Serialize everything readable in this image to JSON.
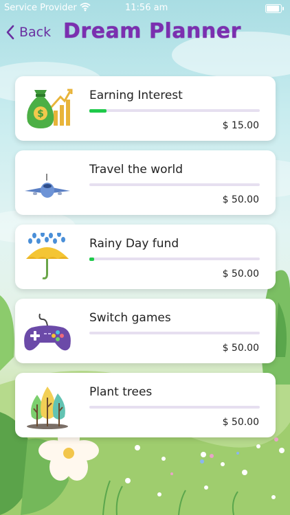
{
  "status_bar": {
    "carrier": "Service Provider",
    "time": "11:56 am"
  },
  "nav": {
    "back_label": "Back",
    "title": "Dream Planner"
  },
  "goals": [
    {
      "name": "Earning Interest",
      "amount": "$ 15.00",
      "progress": 0.1,
      "icon": "money-bag-icon"
    },
    {
      "name": "Travel the world",
      "amount": "$ 50.00",
      "progress": 0.0,
      "icon": "airplane-icon"
    },
    {
      "name": "Rainy Day fund",
      "amount": "$ 50.00",
      "progress": 0.03,
      "icon": "umbrella-icon"
    },
    {
      "name": "Switch games",
      "amount": "$ 50.00",
      "progress": 0.0,
      "icon": "game-controller-icon"
    },
    {
      "name": "Plant trees",
      "amount": "$ 50.00",
      "progress": 0.0,
      "icon": "trees-icon"
    }
  ],
  "colors": {
    "accent": "#7b2fb0",
    "progress": "#1fc94a",
    "track": "#e6dff0"
  }
}
